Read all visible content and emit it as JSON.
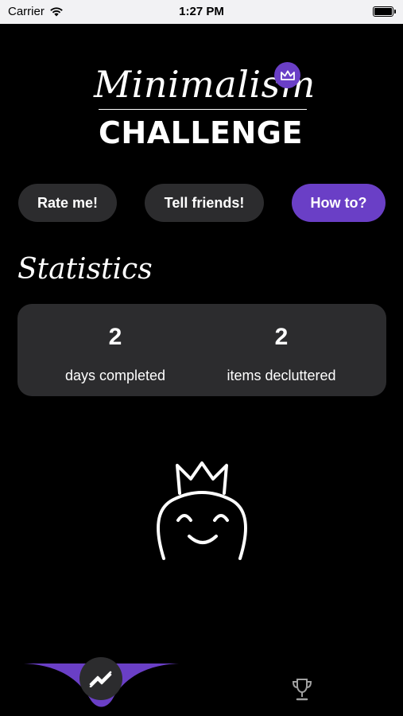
{
  "status_bar": {
    "carrier": "Carrier",
    "time": "1:27 PM"
  },
  "logo": {
    "script_text": "Minimalism",
    "bold_text": "CHALLENGE"
  },
  "buttons": {
    "rate": "Rate me!",
    "tell": "Tell friends!",
    "how": "How to?"
  },
  "statistics": {
    "title": "Statistics",
    "items": [
      {
        "value": "2",
        "label": "days completed"
      },
      {
        "value": "2",
        "label": "items decluttered"
      }
    ]
  },
  "tabs": [
    {
      "icon": "progress-chart-icon",
      "active": true
    },
    {
      "icon": "trophy-icon",
      "active": false
    }
  ],
  "colors": {
    "accent": "#6a3fc6",
    "card": "#2c2c2e",
    "background": "#000000"
  }
}
